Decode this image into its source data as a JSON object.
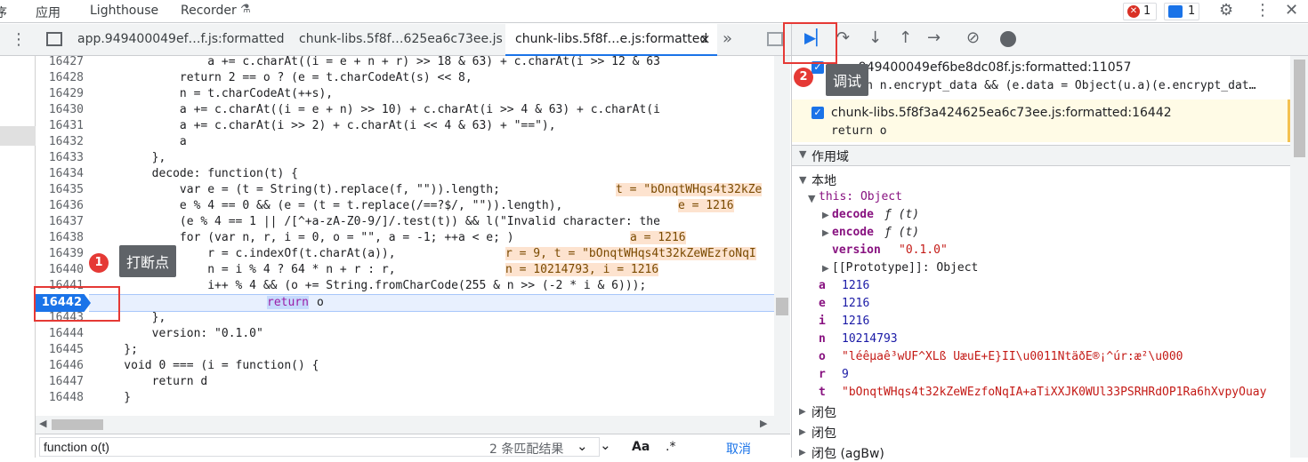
{
  "topbar": {
    "cut_label": "序",
    "app_label": "应用",
    "lighthouse_label": "Lighthouse",
    "recorder_label": "Recorder",
    "error_count": "1",
    "message_count": "1"
  },
  "tabs": {
    "tab1": "app.949400049ef…f.js:formatted",
    "tab2": "chunk-libs.5f8f…625ea6c73ee.js",
    "tab3": "chunk-libs.5f8f…e.js:formatted",
    "tab3_close": "×",
    "more": "»"
  },
  "editor": {
    "lines": [
      {
        "n": "16427",
        "t": "                a += c.charAt((i = e + n + r) >> 18 & 63) + c.charAt(i >> 12 & 63"
      },
      {
        "n": "16428",
        "t": "            return 2 == o ? (e = t.charCodeAt(s) << 8,"
      },
      {
        "n": "16429",
        "t": "            n = t.charCodeAt(++s),"
      },
      {
        "n": "16430",
        "t": "            a += c.charAt((i = e + n) >> 10) + c.charAt(i >> 4 & 63) + c.charAt(i"
      },
      {
        "n": "16431",
        "t": "            a += c.charAt(i >> 2) + c.charAt(i << 4 & 63) + \"==\"),"
      },
      {
        "n": "16432",
        "t": "            a"
      },
      {
        "n": "16433",
        "t": "        },"
      },
      {
        "n": "16434",
        "t": "        decode: function(t) {"
      },
      {
        "n": "16435",
        "t": "            var e = (t = String(t).replace(f, \"\")).length;"
      },
      {
        "n": "16436",
        "t": "            e % 4 == 0 && (e = (t = t.replace(/==?$/, \"\")).length),"
      },
      {
        "n": "16437",
        "t": "            (e % 4 == 1 || /[^+a-zA-Z0-9/]/.test(t)) && l(\"Invalid character: the"
      },
      {
        "n": "16438",
        "t": "            for (var n, r, i = 0, o = \"\", a = -1; ++a < e; )"
      },
      {
        "n": "16439",
        "t": "                r = c.indexOf(t.charAt(a)),"
      },
      {
        "n": "16440",
        "t": "                n = i % 4 ? 64 * n + r : r,"
      },
      {
        "n": "16441",
        "t": "                i++ % 4 && (o += String.fromCharCode(255 & n >> (-2 * i & 6)));"
      },
      {
        "n": "16442",
        "t": "            return o"
      },
      {
        "n": "16443",
        "t": "        },"
      },
      {
        "n": "16444",
        "t": "        version: \"0.1.0\""
      },
      {
        "n": "16445",
        "t": "    };"
      },
      {
        "n": "16446",
        "t": "    void 0 === (i = function() {"
      },
      {
        "n": "16447",
        "t": "        return d"
      },
      {
        "n": "16448",
        "t": "    }"
      }
    ],
    "inline_values": {
      "l16435": "t = \"bOnqtWHqs4t32kZe",
      "l16436": "e = 1216",
      "l16438": "a = 1216",
      "l16439": "r = 9, t = \"bOnqtWHqs4t32kZeWEzfoNqI",
      "l16440": "n = 10214793, i = 1216"
    }
  },
  "annotations": {
    "badge1": "1",
    "tip1": "打断点",
    "badge2": "2",
    "tip2": "调试"
  },
  "search": {
    "value": "function o(t)",
    "result_count": "2 条匹配结果",
    "aa_label": "Aa",
    "regex_label": ".*",
    "cancel_label": "取消"
  },
  "callstack": {
    "item1_file": "app.949400049ef6be8dc08f.js:formatted:11057",
    "item1_code": "return n.encrypt_data && (e.data = Object(u.a)(e.encrypt_dat…",
    "item2_file": "chunk-libs.5f8f3a424625ea6c73ee.js:formatted:16442",
    "item2_code": "return o"
  },
  "scope": {
    "section_title": "作用域",
    "local_title": "本地",
    "this_label": "this: Object",
    "decode_key": "decode",
    "decode_val": "ƒ (t)",
    "encode_key": "encode",
    "encode_val": "ƒ (t)",
    "version_key": "version",
    "version_val": "\"0.1.0\"",
    "proto_label": "[[Prototype]]: Object",
    "a_key": "a",
    "a_val": "1216",
    "e_key": "e",
    "e_val": "1216",
    "i_key": "i",
    "i_val": "1216",
    "n_key": "n",
    "n_val": "10214793",
    "o_key": "o",
    "o_val": "\"léêµaê³\u0019wÚF^XLß Ú\u0003\u0003æ\u0019\u0019uÉ+E\u0019\u0019}ÏI\\u0011ÑtäðE®¡^úr:æ²\\u000",
    "r_key": "r",
    "r_val": "9",
    "t_key": "t",
    "t_val": "\"bOnqtWHqs4t32kZeWEzfoNqIA+aTiXXJK0WUl33PSRHRdOP1Ra6hXvpyOuay",
    "closure1": "闭包",
    "closure2": "闭包",
    "closure3": "闭包 (agBw)"
  },
  "colors": {
    "accent": "#1a73e8",
    "annotation_red": "#e53935",
    "highlight_line": "#e8f0fe",
    "paused_bg": "#fffbe6"
  }
}
